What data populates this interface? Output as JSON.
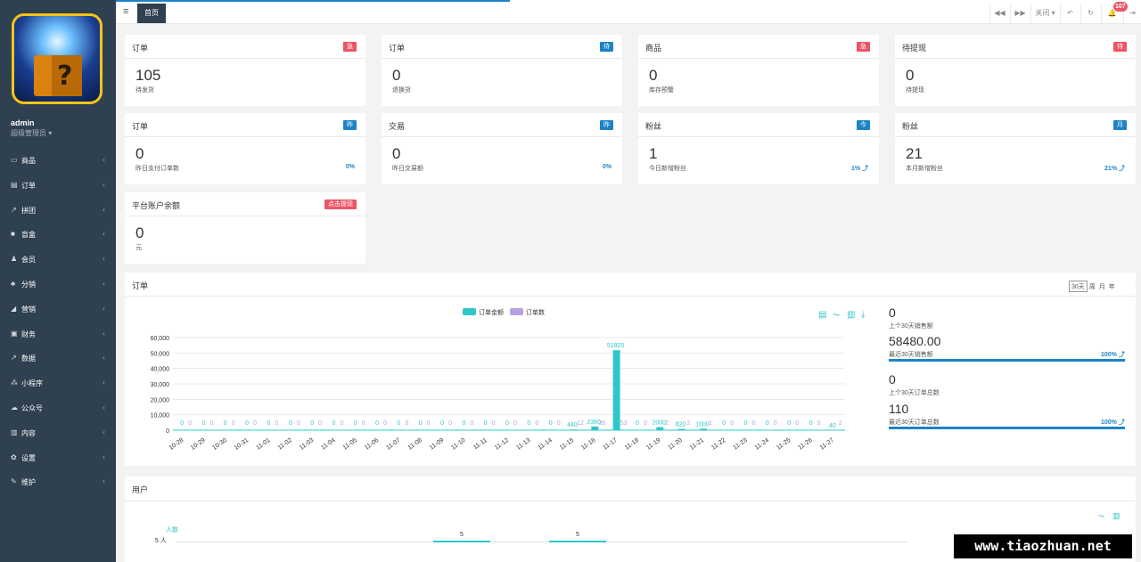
{
  "sidebar": {
    "user_name": "admin",
    "user_role": "超级管理员 ▾",
    "items": [
      {
        "label": "商品",
        "icon": "monitor-icon",
        "glyph": "▭"
      },
      {
        "label": "订单",
        "icon": "file-icon",
        "glyph": "▤"
      },
      {
        "label": "拼团",
        "icon": "line-chart-icon",
        "glyph": "↗"
      },
      {
        "label": "盲盒",
        "icon": "box-icon",
        "glyph": "■"
      },
      {
        "label": "会员",
        "icon": "user-icon",
        "glyph": "♟"
      },
      {
        "label": "分销",
        "icon": "users-icon",
        "glyph": "♣"
      },
      {
        "label": "营销",
        "icon": "send-icon",
        "glyph": "◢"
      },
      {
        "label": "财务",
        "icon": "money-icon",
        "glyph": "▣"
      },
      {
        "label": "数据",
        "icon": "area-chart-icon",
        "glyph": "↗"
      },
      {
        "label": "小程序",
        "icon": "cubes-icon",
        "glyph": "⁂"
      },
      {
        "label": "公众号",
        "icon": "wechat-icon",
        "glyph": "☁"
      },
      {
        "label": "内容",
        "icon": "book-icon",
        "glyph": "▥"
      },
      {
        "label": "设置",
        "icon": "gear-icon",
        "glyph": "✿"
      },
      {
        "label": "维护",
        "icon": "wrench-icon",
        "glyph": "✎"
      }
    ]
  },
  "topbar": {
    "menu_icon": "≡",
    "home_tab": "首页",
    "back": "◀◀",
    "fwd": "▶▶",
    "close": "关闭 ▾",
    "undo": "↶",
    "refresh": "↻",
    "bell": "🔔",
    "badge": "107",
    "exit": "⇥"
  },
  "cards": [
    {
      "title": "订单",
      "tag": "急",
      "value": "105",
      "sub": "待发货",
      "pct": ""
    },
    {
      "title": "订单",
      "tag": "待",
      "value": "0",
      "sub": "退换货",
      "pct": ""
    },
    {
      "title": "商品",
      "tag": "急",
      "value": "0",
      "sub": "库存预警",
      "pct": ""
    },
    {
      "title": "待提现",
      "tag": "待",
      "value": "0",
      "sub": "待提现",
      "pct": ""
    },
    {
      "title": "订单",
      "tag": "昨",
      "value": "0",
      "sub": "昨日支付订单数",
      "pct": "0%"
    },
    {
      "title": "交易",
      "tag": "昨",
      "value": "0",
      "sub": "昨日交易额",
      "pct": "0%"
    },
    {
      "title": "粉丝",
      "tag": "今",
      "value": "1",
      "sub": "今日新增粉丝",
      "pct": "1% ⤴"
    },
    {
      "title": "粉丝",
      "tag": "月",
      "value": "21",
      "sub": "本月新增粉丝",
      "pct": "21% ⤴"
    },
    {
      "title": "平台账户余额",
      "tag": "点击提现",
      "value": "0",
      "sub": "元",
      "pct": ""
    }
  ],
  "colors": {
    "accent": "#1c84c6",
    "danger": "#ed5565",
    "sidebar": "#2f4050",
    "teal": "#2ec7c9",
    "purple": "#b6a2de"
  },
  "order_panel": {
    "title": "订单",
    "ranges": [
      "30天",
      "周",
      "月",
      "年"
    ],
    "tools": [
      "▤",
      "⏦",
      "▥",
      "⤓"
    ]
  },
  "chart_data": {
    "type": "bar",
    "categories": [
      "10-28",
      "10-29",
      "10-30",
      "10-31",
      "11-01",
      "11-02",
      "11-03",
      "11-04",
      "11-05",
      "11-06",
      "11-07",
      "11-08",
      "11-09",
      "11-10",
      "11-11",
      "11-12",
      "11-13",
      "11-14",
      "11-15",
      "11-16",
      "11-17",
      "11-18",
      "11-19",
      "11-20",
      "11-21",
      "11-22",
      "11-23",
      "11-24",
      "11-25",
      "11-26",
      "11-27"
    ],
    "series": [
      {
        "name": "订单金额",
        "values": [
          0,
          0,
          0,
          0,
          0,
          0,
          0,
          0,
          0,
          0,
          0,
          0,
          0,
          0,
          0,
          0,
          0,
          0,
          440,
          2360,
          51820,
          0,
          2000,
          820,
          1000,
          0,
          0,
          0,
          0,
          0,
          40
        ]
      },
      {
        "name": "订单数",
        "values": [
          0,
          0,
          0,
          0,
          0,
          0,
          0,
          0,
          0,
          0,
          0,
          0,
          0,
          0,
          0,
          0,
          0,
          0,
          12,
          38,
          53,
          0,
          2,
          2,
          1,
          0,
          0,
          0,
          0,
          0,
          2
        ]
      }
    ],
    "yticks": [
      "0",
      "10,000",
      "20,000",
      "30,000",
      "40,000",
      "50,000",
      "60,000"
    ],
    "ylim": [
      0,
      60000
    ],
    "legend": "top-center"
  },
  "stats": [
    {
      "value": "0",
      "label": "上个30天销售额",
      "pct": ""
    },
    {
      "value": "58480.00",
      "label": "最近30天销售额",
      "pct": "100% ⤴"
    },
    {
      "value": "0",
      "label": "上个30天订单总数",
      "pct": ""
    },
    {
      "value": "110",
      "label": "最近30天订单总数",
      "pct": "100% ⤴"
    }
  ],
  "user_panel": {
    "title": "用户",
    "ylabel": "人数",
    "ytick": "5 人",
    "bar_values": [
      "5",
      "5"
    ],
    "tools": [
      "⏦",
      "▥"
    ]
  },
  "watermark": "www.tiaozhuan.net"
}
